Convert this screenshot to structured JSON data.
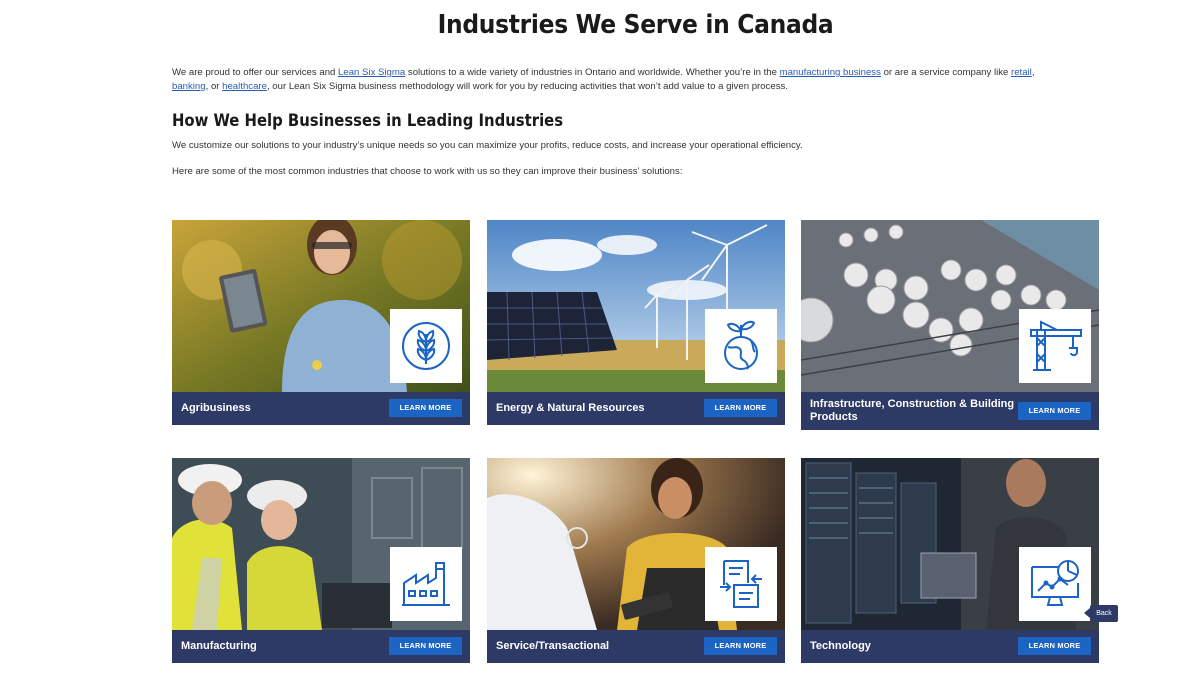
{
  "page": {
    "title": "Industries We Serve in Canada",
    "intro": {
      "t1": "We are proud to offer our services and ",
      "link1": "Lean Six Sigma",
      "t2": " solutions to a wide variety of industries in Ontario and worldwide. Whether you’re in the ",
      "link2": "manufacturing business",
      "t3": " or are a service company like ",
      "link3": "retail",
      "t4": ", ",
      "link4": "banking",
      "t5": ", or ",
      "link5": "healthcare",
      "t6": ", our Lean Six Sigma business methodology will work for you by reducing activities that won’t add value to a given process."
    },
    "subheading": "How We Help Businesses in Leading Industries",
    "para1": "We customize our solutions to your industry’s unique needs so you can maximize your profits, reduce costs, and increase your operational efficiency.",
    "para2": "Here are some of the most common industries that choose to work with us so they can improve their business’ solutions:"
  },
  "cards": [
    {
      "label": "Agribusiness",
      "button": "LEARN MORE",
      "icon": "wheat-icon"
    },
    {
      "label": "Energy & Natural Resources",
      "button": "LEARN MORE",
      "icon": "globe-plant-icon"
    },
    {
      "label": "Infrastructure, Construction & Building Products",
      "button": "LEARN MORE",
      "icon": "crane-icon"
    },
    {
      "label": "Manufacturing",
      "button": "LEARN MORE",
      "icon": "factory-icon"
    },
    {
      "label": "Service/Transactional",
      "button": "LEARN MORE",
      "icon": "document-exchange-icon"
    },
    {
      "label": "Technology",
      "button": "LEARN MORE",
      "icon": "monitor-chart-icon"
    }
  ],
  "back_label": "Back",
  "colors": {
    "bar": "#2e3a66",
    "button": "#1c64c3",
    "icon": "#1c64c3"
  }
}
